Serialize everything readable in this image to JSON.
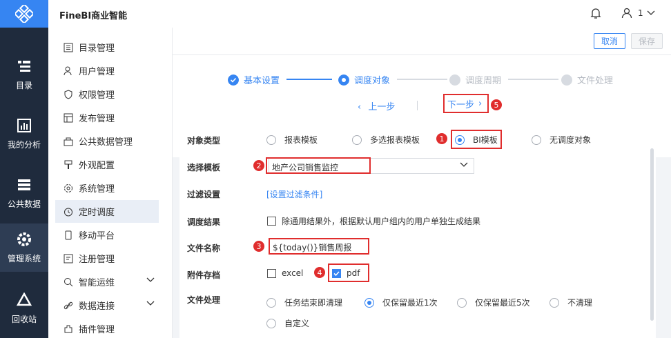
{
  "app": {
    "title": "FineBI商业智能"
  },
  "user": {
    "name": "1"
  },
  "nav": [
    {
      "label": "目录",
      "icon": "catalog-icon"
    },
    {
      "label": "我的分析",
      "icon": "analysis-icon"
    },
    {
      "label": "公共数据",
      "icon": "database-icon"
    },
    {
      "label": "管理系统",
      "icon": "gear-icon",
      "active": true
    },
    {
      "label": "回收站",
      "icon": "recycle-icon"
    }
  ],
  "menu": [
    {
      "label": "目录管理",
      "icon": "list-icon"
    },
    {
      "label": "用户管理",
      "icon": "user-icon"
    },
    {
      "label": "权限管理",
      "icon": "shield-icon"
    },
    {
      "label": "发布管理",
      "icon": "publish-icon"
    },
    {
      "label": "公共数据管理",
      "icon": "box-icon"
    },
    {
      "label": "外观配置",
      "icon": "brush-icon"
    },
    {
      "label": "系统管理",
      "icon": "settings-icon"
    },
    {
      "label": "定时调度",
      "icon": "clock-icon",
      "active": true
    },
    {
      "label": "移动平台",
      "icon": "mobile-icon"
    },
    {
      "label": "注册管理",
      "icon": "register-icon"
    },
    {
      "label": "智能运维",
      "icon": "ops-icon",
      "expandable": true
    },
    {
      "label": "数据连接",
      "icon": "link-icon",
      "expandable": true
    },
    {
      "label": "插件管理",
      "icon": "plugin-icon"
    }
  ],
  "toolbar": {
    "cancel_label": "取消",
    "save_label": "保存"
  },
  "steps": [
    {
      "label": "基本设置",
      "state": "done"
    },
    {
      "label": "调度对象",
      "state": "current"
    },
    {
      "label": "调度周期",
      "state": "pending"
    },
    {
      "label": "文件处理",
      "state": "pending"
    }
  ],
  "nav_buttons": {
    "prev": "上一步",
    "next": "下一步"
  },
  "form": {
    "object_type": {
      "label": "对象类型",
      "options": [
        "报表模板",
        "多选报表模板",
        "BI模板",
        "无调度对象"
      ],
      "selected": "BI模板"
    },
    "template": {
      "label": "选择模板",
      "value": "地产公司销售监控"
    },
    "filter": {
      "label": "过滤设置",
      "link": "[设置过滤条件]"
    },
    "result": {
      "label": "调度结果",
      "checkbox": "除通用结果外，根据默认用户组内的用户单独生成结果",
      "checked": false
    },
    "file_name": {
      "label": "文件名称",
      "value": "${today()}销售周报"
    },
    "attachment": {
      "label": "附件存档",
      "options": [
        {
          "label": "excel",
          "checked": false
        },
        {
          "label": "pdf",
          "checked": true
        }
      ]
    },
    "file_handling": {
      "label": "文件处理",
      "options": [
        "任务结束即清理",
        "仅保留最近1次",
        "仅保留最近5次",
        "不清理",
        "自定义"
      ],
      "selected": "仅保留最近1次"
    }
  },
  "badges": [
    "1",
    "2",
    "3",
    "4",
    "5"
  ],
  "colors": {
    "accent": "#3685f2",
    "nav_bg": "#1f2b3d",
    "highlight_red": "#e02d2d"
  }
}
